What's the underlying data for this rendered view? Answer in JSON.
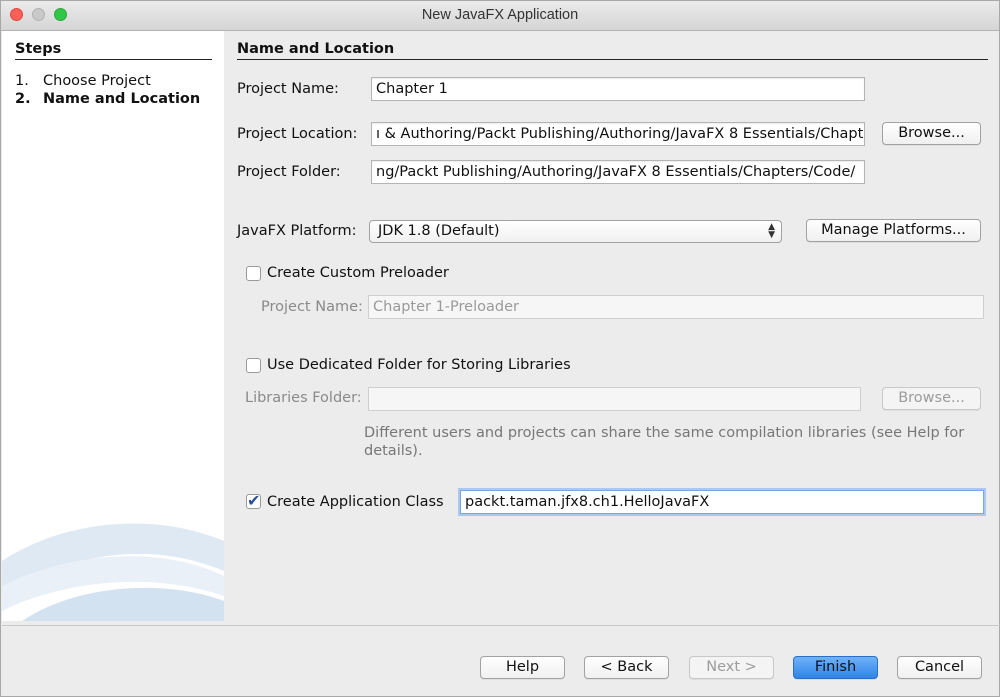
{
  "window": {
    "title": "New JavaFX Application"
  },
  "steps": {
    "heading": "Steps",
    "items": [
      {
        "num": "1.",
        "label": "Choose Project"
      },
      {
        "num": "2.",
        "label": "Name and Location"
      }
    ]
  },
  "section": {
    "heading": "Name and Location"
  },
  "project_name": {
    "label": "Project Name:",
    "value": "Chapter 1"
  },
  "project_location": {
    "label": "Project Location:",
    "value": "ı & Authoring/Packt Publishing/Authoring/JavaFX 8 Essentials/Chapt",
    "browse_label": "Browse..."
  },
  "project_folder": {
    "label": "Project Folder:",
    "value": "ng/Packt Publishing/Authoring/JavaFX 8 Essentials/Chapters/Code/"
  },
  "platform": {
    "label": "JavaFX Platform:",
    "selected": "JDK 1.8 (Default)",
    "manage_label": "Manage Platforms..."
  },
  "preloader": {
    "label": "Create Custom Preloader",
    "checked": false,
    "name_label": "Project Name:",
    "name_value": "Chapter 1-Preloader"
  },
  "libraries": {
    "label": "Use Dedicated Folder for Storing Libraries",
    "checked": false,
    "folder_label": "Libraries Folder:",
    "folder_value": "",
    "browse_label": "Browse...",
    "help_text": "Different users and projects can share the same compilation libraries (see Help for details)."
  },
  "app_class": {
    "label": "Create Application Class",
    "checked": true,
    "value": "packt.taman.jfx8.ch1.HelloJavaFX"
  },
  "buttons": {
    "help": "Help",
    "back": "< Back",
    "next": "Next >",
    "finish": "Finish",
    "cancel": "Cancel"
  },
  "colors": {
    "default_button": "#2f84ea",
    "sidebar_bg": "#ffffff",
    "dialog_bg": "#ececec"
  }
}
